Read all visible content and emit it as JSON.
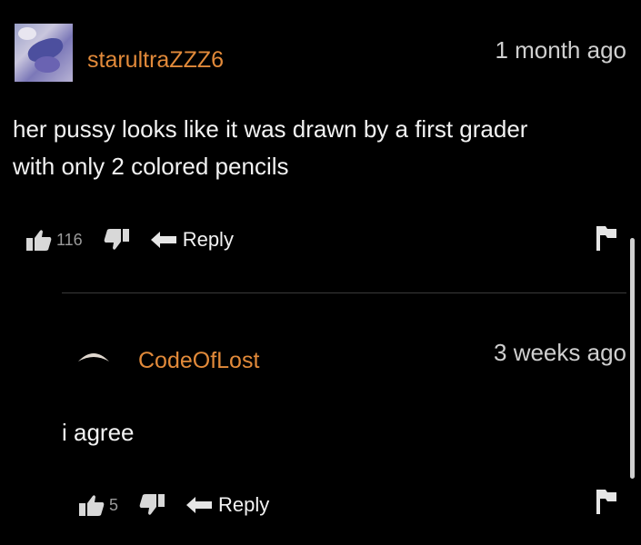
{
  "comments": [
    {
      "username": "starultraZZZ6",
      "time": "1 month ago",
      "text_line1": "her pussy looks like it was drawn by a first grader",
      "text_line2": "with only 2 colored pencils",
      "likes": "116",
      "reply_label": "Reply"
    },
    {
      "username": "CodeOfLost",
      "time": "3 weeks ago",
      "text_line1": "i agree",
      "likes": "5",
      "reply_label": "Reply"
    }
  ],
  "colors": {
    "username": "#e28a3a",
    "background": "#000000",
    "text": "#f2f2f2"
  },
  "icons": [
    "thumbs-up-icon",
    "thumbs-down-icon",
    "reply-arrow-icon",
    "flag-icon"
  ]
}
